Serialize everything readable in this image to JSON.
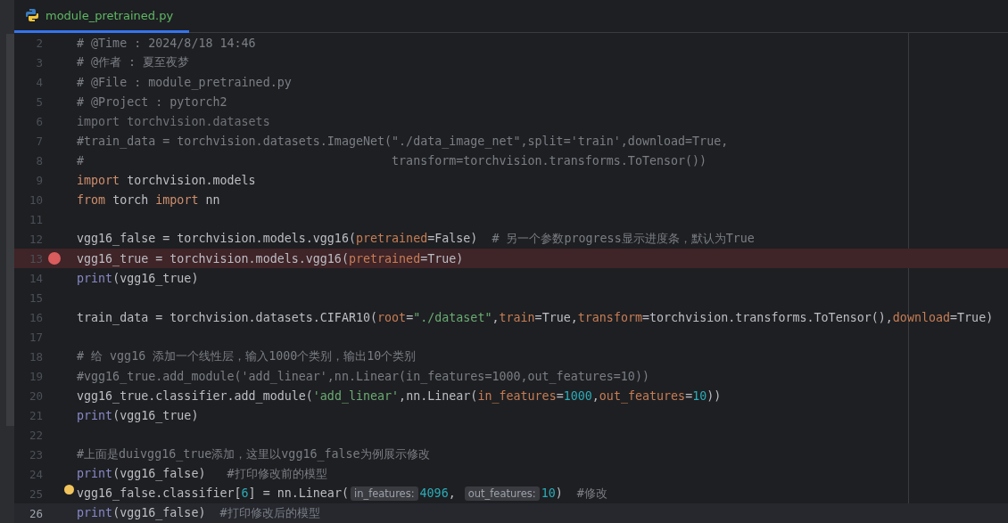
{
  "tab": {
    "title": "module_pretrained.py",
    "selected": true
  },
  "lines": [
    {
      "number": "2",
      "tokens": [
        {
          "kind": "comment",
          "text": "# @Time : 2024/8/18 14:46"
        }
      ]
    },
    {
      "number": "3",
      "tokens": [
        {
          "kind": "comment",
          "text": "# @作者 : 夏至夜梦"
        }
      ]
    },
    {
      "number": "4",
      "tokens": [
        {
          "kind": "comment",
          "text": "# @File : module_pretrained.py"
        }
      ]
    },
    {
      "number": "5",
      "tokens": [
        {
          "kind": "comment",
          "text": "# @Project : pytorch2"
        }
      ]
    },
    {
      "number": "6",
      "tokens": [
        {
          "kind": "unused",
          "text": "import torchvision.datasets"
        }
      ]
    },
    {
      "number": "7",
      "tokens": [
        {
          "kind": "comment",
          "text": "#train_data = torchvision.datasets.ImageNet(\"./data_image_net\",split='train',download=True,"
        }
      ]
    },
    {
      "number": "8",
      "tokens": [
        {
          "kind": "comment",
          "text": "#                                           transform=torchvision.transforms.ToTensor())"
        }
      ]
    },
    {
      "number": "9",
      "tokens": [
        {
          "kind": "keyword",
          "text": "import"
        },
        {
          "kind": "plain",
          "text": " torchvision.models"
        }
      ]
    },
    {
      "number": "10",
      "tokens": [
        {
          "kind": "keyword",
          "text": "from"
        },
        {
          "kind": "plain",
          "text": " torch "
        },
        {
          "kind": "keyword",
          "text": "import"
        },
        {
          "kind": "plain",
          "text": " nn"
        }
      ]
    },
    {
      "number": "11"
    },
    {
      "number": "12",
      "tokens": [
        {
          "kind": "plain",
          "text": "vgg16_false = torchvision.models.vgg16("
        },
        {
          "kind": "param",
          "text": "pretrained"
        },
        {
          "kind": "plain",
          "text": "=False)"
        },
        {
          "kind": "comment",
          "text": "  # 另一个参数progress显示进度条，默认为True"
        }
      ]
    },
    {
      "number": "13",
      "breakpoint": true,
      "tokens": [
        {
          "kind": "plain",
          "text": "vgg16_true = torchvision.models.vgg16("
        },
        {
          "kind": "param",
          "text": "pretrained"
        },
        {
          "kind": "plain",
          "text": "=True)"
        }
      ]
    },
    {
      "number": "14",
      "tokens": [
        {
          "kind": "builtin",
          "text": "print"
        },
        {
          "kind": "plain",
          "text": "(vgg16_true)"
        }
      ]
    },
    {
      "number": "15"
    },
    {
      "number": "16",
      "tokens": [
        {
          "kind": "plain",
          "text": "train_data = torchvision.datasets.CIFAR10("
        },
        {
          "kind": "param",
          "text": "root"
        },
        {
          "kind": "plain",
          "text": "="
        },
        {
          "kind": "string",
          "text": "\"./dataset\""
        },
        {
          "kind": "plain",
          "text": ","
        },
        {
          "kind": "param",
          "text": "train"
        },
        {
          "kind": "plain",
          "text": "=True,"
        },
        {
          "kind": "param",
          "text": "transform"
        },
        {
          "kind": "plain",
          "text": "=torchvision.transforms.ToTensor(),"
        },
        {
          "kind": "param",
          "text": "download"
        },
        {
          "kind": "plain",
          "text": "=True)"
        }
      ]
    },
    {
      "number": "17"
    },
    {
      "number": "18",
      "tokens": [
        {
          "kind": "comment",
          "text": "# 给 vgg16 添加一个线性层，输入1000个类别，输出10个类别"
        }
      ]
    },
    {
      "number": "19",
      "tokens": [
        {
          "kind": "comment",
          "text": "#vgg16_true.add_module('add_linear',nn.Linear(in_features=1000,out_features=10))"
        }
      ]
    },
    {
      "number": "20",
      "tokens": [
        {
          "kind": "plain",
          "text": "vgg16_true.classifier.add_module("
        },
        {
          "kind": "string",
          "text": "'add_linear'"
        },
        {
          "kind": "plain",
          "text": ",nn.Linear("
        },
        {
          "kind": "param",
          "text": "in_features"
        },
        {
          "kind": "plain",
          "text": "="
        },
        {
          "kind": "number",
          "text": "1000"
        },
        {
          "kind": "plain",
          "text": ","
        },
        {
          "kind": "param",
          "text": "out_features"
        },
        {
          "kind": "plain",
          "text": "="
        },
        {
          "kind": "number",
          "text": "10"
        },
        {
          "kind": "plain",
          "text": "))"
        }
      ]
    },
    {
      "number": "21",
      "tokens": [
        {
          "kind": "builtin",
          "text": "print"
        },
        {
          "kind": "plain",
          "text": "(vgg16_true)"
        }
      ]
    },
    {
      "number": "22"
    },
    {
      "number": "23",
      "tokens": [
        {
          "kind": "comment",
          "text": "#上面是duivgg16_true添加，这里以vgg16_false为例展示修改"
        }
      ]
    },
    {
      "number": "24",
      "tokens": [
        {
          "kind": "builtin",
          "text": "print"
        },
        {
          "kind": "plain",
          "text": "(vgg16_false)   "
        },
        {
          "kind": "comment",
          "text": "#打印修改前的模型"
        }
      ]
    },
    {
      "number": "25",
      "bulb": true,
      "tokens": [
        {
          "kind": "plain",
          "text": "vgg16_false.classifier["
        },
        {
          "kind": "number",
          "text": "6"
        },
        {
          "kind": "plain",
          "text": "] = nn.Linear("
        },
        {
          "kind": "hint",
          "text": "in_features:"
        },
        {
          "kind": "number",
          "text": "4096"
        },
        {
          "kind": "plain",
          "text": ", "
        },
        {
          "kind": "hint",
          "text": "out_features:"
        },
        {
          "kind": "number",
          "text": "10"
        },
        {
          "kind": "plain",
          "text": ")  "
        },
        {
          "kind": "comment",
          "text": "#修改"
        }
      ]
    },
    {
      "number": "26",
      "current": true,
      "tokens": [
        {
          "kind": "builtin",
          "text": "print"
        },
        {
          "kind": "plain",
          "text": "(vgg16_false)  "
        },
        {
          "kind": "comment",
          "text": "#打印修改后的模型"
        }
      ]
    }
  ]
}
